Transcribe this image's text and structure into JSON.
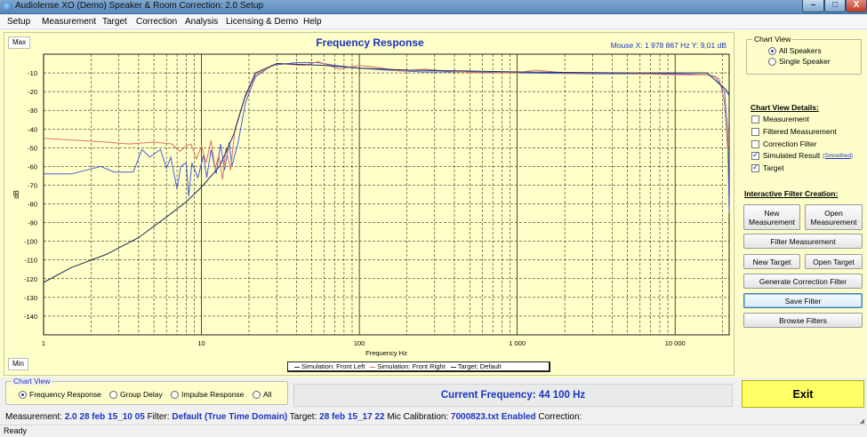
{
  "window": {
    "title": "Audiolense XO (Demo) Speaker & Room Correction: 2.0 Setup",
    "minimize": "–",
    "maximize": "□",
    "close": "X"
  },
  "menu": [
    "Setup",
    "Measurement",
    "Target",
    "Correction",
    "Analysis",
    "Licensing & Demo",
    "Help"
  ],
  "chart": {
    "max_label": "Max",
    "min_label": "Min",
    "mouse_readout": "Mouse X: 1 978 867 Hz   Y: 9,01 dB"
  },
  "chart_data": {
    "type": "line",
    "title": "Frequency Response",
    "xlabel": "Frequency Hz",
    "ylabel": "dB",
    "xscale": "log",
    "xlim": [
      1,
      22000
    ],
    "ylim": [
      -150,
      0
    ],
    "x_ticks": [
      1,
      10,
      100,
      1000,
      10000
    ],
    "x_tick_labels": [
      "1",
      "10",
      "100",
      "1 000",
      "10 000"
    ],
    "y_ticks": [
      -10,
      -20,
      -30,
      -40,
      -50,
      -60,
      -70,
      -80,
      -90,
      -100,
      -110,
      -120,
      -130,
      -140
    ],
    "y_tick_labels": [
      "-10",
      "-20",
      "-30",
      "-40",
      "-50",
      "-60",
      "-70",
      "-80",
      "-90",
      "-100",
      "-110",
      "-120",
      "-130",
      "-140"
    ],
    "grid": true,
    "legend_position": "bottom-center",
    "series": [
      {
        "name": "Simulation: Front Left",
        "color": "#4a5fd8",
        "points": [
          [
            1,
            -64
          ],
          [
            1.5,
            -64
          ],
          [
            2.3,
            -60
          ],
          [
            2.8,
            -63
          ],
          [
            3.7,
            -63
          ],
          [
            4.2,
            -51
          ],
          [
            4.7,
            -55
          ],
          [
            5.5,
            -51
          ],
          [
            6,
            -61
          ],
          [
            6.4,
            -55
          ],
          [
            7,
            -72
          ],
          [
            7.4,
            -60
          ],
          [
            8,
            -58
          ],
          [
            8.3,
            -76
          ],
          [
            8.7,
            -58
          ],
          [
            9.5,
            -66
          ],
          [
            10.3,
            -54
          ],
          [
            10.8,
            -66
          ],
          [
            11.5,
            -51
          ],
          [
            12.4,
            -64
          ],
          [
            13.2,
            -48
          ],
          [
            14,
            -62
          ],
          [
            15,
            -47
          ],
          [
            15.6,
            -60
          ],
          [
            16,
            -56
          ],
          [
            17,
            -48
          ],
          [
            19,
            -26
          ],
          [
            22,
            -12
          ],
          [
            28,
            -6
          ],
          [
            40,
            -4.5
          ],
          [
            55,
            -4.5
          ],
          [
            70,
            -6
          ],
          [
            100,
            -7.5
          ],
          [
            150,
            -8.5
          ],
          [
            250,
            -9.5
          ],
          [
            500,
            -9.5
          ],
          [
            1000,
            -10
          ],
          [
            3000,
            -10.5
          ],
          [
            10000,
            -10.5
          ],
          [
            16000,
            -11
          ],
          [
            18000,
            -12
          ],
          [
            20500,
            -20
          ],
          [
            21500,
            -40
          ],
          [
            22000,
            -85
          ]
        ]
      },
      {
        "name": "Simulation: Front Right",
        "color": "#e0706c",
        "points": [
          [
            1,
            -45
          ],
          [
            1.6,
            -46
          ],
          [
            2.5,
            -47
          ],
          [
            3.5,
            -48
          ],
          [
            5,
            -47
          ],
          [
            6.5,
            -48
          ],
          [
            7.3,
            -52
          ],
          [
            8,
            -49
          ],
          [
            8.6,
            -48
          ],
          [
            9.3,
            -56
          ],
          [
            10,
            -49
          ],
          [
            10.7,
            -58
          ],
          [
            11.5,
            -46
          ],
          [
            12.2,
            -61
          ],
          [
            12.9,
            -54
          ],
          [
            13.6,
            -67
          ],
          [
            14.3,
            -50
          ],
          [
            15.3,
            -62
          ],
          [
            16.3,
            -40
          ],
          [
            18.5,
            -25
          ],
          [
            22,
            -11
          ],
          [
            30,
            -5
          ],
          [
            45,
            -6
          ],
          [
            55,
            -4
          ],
          [
            75,
            -8
          ],
          [
            85,
            -7
          ],
          [
            100,
            -6
          ],
          [
            130,
            -7
          ],
          [
            180,
            -9
          ],
          [
            260,
            -8
          ],
          [
            350,
            -9
          ],
          [
            600,
            -10
          ],
          [
            1000,
            -10
          ],
          [
            1300,
            -8.5
          ],
          [
            2000,
            -10
          ],
          [
            4000,
            -10
          ],
          [
            10000,
            -11
          ],
          [
            16000,
            -11
          ],
          [
            19000,
            -13
          ],
          [
            20500,
            -25
          ],
          [
            21500,
            -50
          ]
        ]
      },
      {
        "name": "Target: Default",
        "color": "#1d2a5a",
        "points": [
          [
            1,
            -122
          ],
          [
            1.5,
            -114
          ],
          [
            2.5,
            -107
          ],
          [
            4,
            -98
          ],
          [
            6,
            -87
          ],
          [
            8,
            -79
          ],
          [
            10,
            -71
          ],
          [
            13,
            -60
          ],
          [
            16,
            -43
          ],
          [
            19,
            -22
          ],
          [
            22,
            -10
          ],
          [
            30,
            -5
          ],
          [
            60,
            -6
          ],
          [
            100,
            -7.5
          ],
          [
            200,
            -8.5
          ],
          [
            500,
            -9
          ],
          [
            1000,
            -9.5
          ],
          [
            5000,
            -10
          ],
          [
            16000,
            -10
          ],
          [
            18000,
            -14
          ],
          [
            21000,
            -19
          ],
          [
            22000,
            -22
          ]
        ]
      }
    ]
  },
  "chart_view": {
    "caption": "Chart View",
    "options": [
      {
        "label": "All Speakers",
        "selected": true
      },
      {
        "label": "Single Speaker",
        "selected": false
      }
    ]
  },
  "chart_view_details": {
    "title": "Chart View Details:",
    "items": [
      {
        "label": "Measurement",
        "checked": false
      },
      {
        "label": "Filtered Measurement",
        "checked": false
      },
      {
        "label": "Correction Filter",
        "checked": false
      },
      {
        "label": "Simulated Result",
        "checked": true,
        "extra": "(Smoothed)"
      },
      {
        "label": "Target",
        "checked": true
      }
    ]
  },
  "filter_creation": {
    "title": "Interactive Filter Creation:",
    "new_measurement": "New Measurement",
    "open_measurement": "Open Measurement",
    "filter_measurement": "Filter Measurement",
    "new_target": "New Target",
    "open_target": "Open Target",
    "generate_correction_filter": "Generate Correction Filter",
    "save_filter": "Save Filter",
    "browse_filters": "Browse Filters"
  },
  "bottom_view": {
    "caption": "Chart View",
    "options": [
      {
        "label": "Frequency Response",
        "selected": true
      },
      {
        "label": "Group Delay",
        "selected": false
      },
      {
        "label": "Impulse Response",
        "selected": false
      },
      {
        "label": "All",
        "selected": false
      }
    ]
  },
  "current_frequency": "Current Frequency: 44 100 Hz",
  "exit_label": "Exit",
  "status": {
    "measurement_label": "Measurement:",
    "measurement_value": "2.0 28 feb 15_10 05",
    "filter_label": "Filter:",
    "filter_value": "Default (True Time Domain)",
    "target_label": "Target:",
    "target_value": "28 feb 15_17 22",
    "mic_label": "Mic Calibration:",
    "mic_value": "7000823.txt Enabled",
    "correction_label": "Correction:"
  },
  "ready_text": "Ready"
}
